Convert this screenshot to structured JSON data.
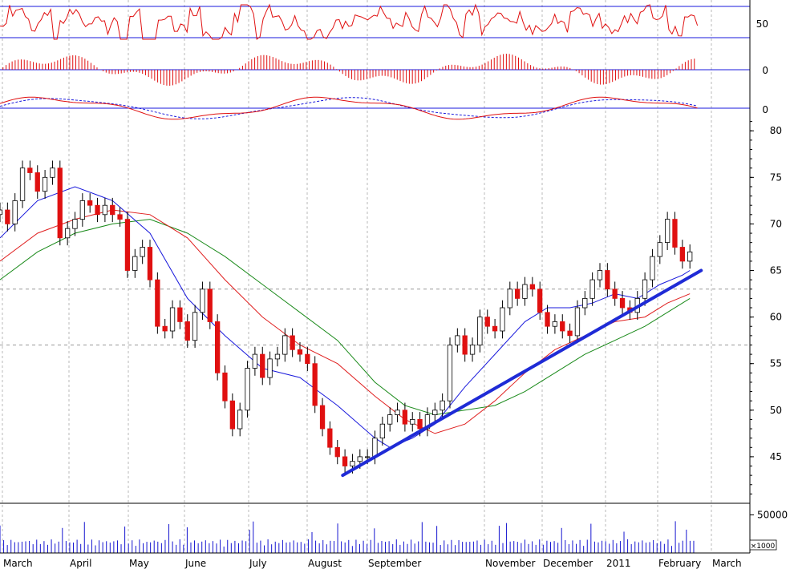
{
  "chart_data": {
    "type": "stock-chart",
    "x_axis": {
      "labels": [
        "March",
        "April",
        "May",
        "June",
        "July",
        "August",
        "September",
        "November",
        "December",
        "2011",
        "February",
        "March"
      ]
    },
    "price_panel": {
      "type": "candlestick",
      "ylim": [
        40,
        82
      ],
      "y_ticks": [
        45,
        50,
        55,
        60,
        65,
        70,
        75,
        80
      ],
      "grid_dashed": [
        57,
        63
      ],
      "trendline": {
        "x": [
          0.457,
          0.935
        ],
        "y": [
          43.0,
          65.0
        ],
        "color": "#1f2bd6"
      },
      "moving_average_colors": {
        "short": "#1a1adc",
        "medium": "#e02020",
        "long": "#1a8a1a"
      },
      "candle_colors": {
        "up": "#ffffff",
        "down": "#e01010"
      },
      "close_series": [
        [
          0.0,
          71.5
        ],
        [
          0.01,
          70.0
        ],
        [
          0.02,
          72.5
        ],
        [
          0.03,
          76.0
        ],
        [
          0.04,
          75.5
        ],
        [
          0.05,
          73.5
        ],
        [
          0.06,
          75.0
        ],
        [
          0.07,
          76.0
        ],
        [
          0.08,
          68.5
        ],
        [
          0.09,
          69.5
        ],
        [
          0.1,
          70.5
        ],
        [
          0.11,
          72.5
        ],
        [
          0.12,
          72.0
        ],
        [
          0.13,
          71.0
        ],
        [
          0.14,
          72.0
        ],
        [
          0.15,
          71.0
        ],
        [
          0.16,
          70.5
        ],
        [
          0.17,
          65.0
        ],
        [
          0.18,
          66.5
        ],
        [
          0.19,
          67.5
        ],
        [
          0.2,
          64.0
        ],
        [
          0.21,
          59.0
        ],
        [
          0.22,
          58.5
        ],
        [
          0.23,
          61.0
        ],
        [
          0.24,
          59.5
        ],
        [
          0.25,
          57.5
        ],
        [
          0.26,
          60.5
        ],
        [
          0.27,
          63.0
        ],
        [
          0.28,
          59.5
        ],
        [
          0.29,
          54.0
        ],
        [
          0.3,
          51.0
        ],
        [
          0.31,
          48.0
        ],
        [
          0.32,
          50.0
        ],
        [
          0.33,
          54.5
        ],
        [
          0.34,
          56.0
        ],
        [
          0.35,
          53.5
        ],
        [
          0.36,
          55.5
        ],
        [
          0.37,
          56.0
        ],
        [
          0.38,
          58.0
        ],
        [
          0.39,
          56.5
        ],
        [
          0.4,
          56.0
        ],
        [
          0.41,
          55.0
        ],
        [
          0.42,
          50.5
        ],
        [
          0.43,
          48.0
        ],
        [
          0.44,
          46.0
        ],
        [
          0.45,
          45.0
        ],
        [
          0.46,
          44.0
        ],
        [
          0.47,
          44.5
        ],
        [
          0.48,
          45.0
        ],
        [
          0.49,
          45.0
        ],
        [
          0.5,
          47.0
        ],
        [
          0.51,
          48.5
        ],
        [
          0.52,
          49.5
        ],
        [
          0.53,
          50.0
        ],
        [
          0.54,
          48.5
        ],
        [
          0.55,
          49.0
        ],
        [
          0.56,
          48.0
        ],
        [
          0.57,
          49.5
        ],
        [
          0.58,
          50.0
        ],
        [
          0.59,
          51.0
        ],
        [
          0.6,
          57.0
        ],
        [
          0.61,
          58.0
        ],
        [
          0.62,
          56.0
        ],
        [
          0.63,
          57.0
        ],
        [
          0.64,
          60.0
        ],
        [
          0.65,
          59.0
        ],
        [
          0.66,
          58.5
        ],
        [
          0.67,
          61.0
        ],
        [
          0.68,
          63.0
        ],
        [
          0.69,
          62.0
        ],
        [
          0.7,
          63.5
        ],
        [
          0.71,
          63.0
        ],
        [
          0.72,
          60.5
        ],
        [
          0.73,
          59.0
        ],
        [
          0.74,
          59.5
        ],
        [
          0.75,
          58.5
        ],
        [
          0.76,
          58.0
        ],
        [
          0.77,
          61.0
        ],
        [
          0.78,
          62.0
        ],
        [
          0.79,
          64.0
        ],
        [
          0.8,
          65.0
        ],
        [
          0.81,
          63.0
        ],
        [
          0.82,
          62.0
        ],
        [
          0.83,
          61.0
        ],
        [
          0.84,
          60.5
        ],
        [
          0.85,
          62.0
        ],
        [
          0.86,
          64.0
        ],
        [
          0.87,
          66.5
        ],
        [
          0.88,
          68.0
        ],
        [
          0.89,
          70.5
        ],
        [
          0.9,
          67.5
        ],
        [
          0.91,
          66.0
        ],
        [
          0.92,
          67.0
        ]
      ],
      "ma_short": [
        [
          0.0,
          68.5
        ],
        [
          0.05,
          72.5
        ],
        [
          0.1,
          74.0
        ],
        [
          0.15,
          72.5
        ],
        [
          0.2,
          69.0
        ],
        [
          0.25,
          62.0
        ],
        [
          0.3,
          58.0
        ],
        [
          0.35,
          54.5
        ],
        [
          0.4,
          53.5
        ],
        [
          0.45,
          50.5
        ],
        [
          0.5,
          47.0
        ],
        [
          0.52,
          46.0
        ],
        [
          0.55,
          47.0
        ],
        [
          0.58,
          48.5
        ],
        [
          0.62,
          52.5
        ],
        [
          0.66,
          56.0
        ],
        [
          0.7,
          59.5
        ],
        [
          0.73,
          61.0
        ],
        [
          0.76,
          61.0
        ],
        [
          0.79,
          61.5
        ],
        [
          0.82,
          62.5
        ],
        [
          0.85,
          62.0
        ],
        [
          0.88,
          63.5
        ],
        [
          0.91,
          64.5
        ],
        [
          0.92,
          65.0
        ]
      ],
      "ma_medium": [
        [
          0.0,
          66.0
        ],
        [
          0.05,
          69.0
        ],
        [
          0.1,
          70.5
        ],
        [
          0.15,
          71.5
        ],
        [
          0.2,
          71.0
        ],
        [
          0.25,
          68.5
        ],
        [
          0.3,
          64.0
        ],
        [
          0.35,
          60.0
        ],
        [
          0.4,
          57.0
        ],
        [
          0.45,
          55.0
        ],
        [
          0.5,
          51.5
        ],
        [
          0.54,
          49.0
        ],
        [
          0.58,
          47.5
        ],
        [
          0.62,
          48.5
        ],
        [
          0.66,
          51.0
        ],
        [
          0.7,
          54.0
        ],
        [
          0.74,
          56.5
        ],
        [
          0.78,
          58.0
        ],
        [
          0.82,
          59.5
        ],
        [
          0.86,
          60.0
        ],
        [
          0.89,
          61.5
        ],
        [
          0.92,
          62.5
        ]
      ],
      "ma_long": [
        [
          0.0,
          64.0
        ],
        [
          0.05,
          67.0
        ],
        [
          0.1,
          69.0
        ],
        [
          0.15,
          70.0
        ],
        [
          0.2,
          70.5
        ],
        [
          0.25,
          69.0
        ],
        [
          0.3,
          66.5
        ],
        [
          0.35,
          63.5
        ],
        [
          0.4,
          60.5
        ],
        [
          0.45,
          57.5
        ],
        [
          0.5,
          53.0
        ],
        [
          0.54,
          50.5
        ],
        [
          0.58,
          49.5
        ],
        [
          0.62,
          50.0
        ],
        [
          0.66,
          50.5
        ],
        [
          0.7,
          52.0
        ],
        [
          0.74,
          54.0
        ],
        [
          0.78,
          56.0
        ],
        [
          0.82,
          57.5
        ],
        [
          0.86,
          59.0
        ],
        [
          0.89,
          60.5
        ],
        [
          0.92,
          62.0
        ]
      ]
    },
    "volume_panel": {
      "y_tick_labels": [
        "50000",
        "×1000"
      ],
      "ylim": [
        0,
        60000
      ],
      "bar_color": "#1515d0"
    },
    "rsi_panel": {
      "tick_label": "50",
      "levels": [
        70,
        30
      ],
      "ylim": [
        0,
        100
      ],
      "color": "#e01010"
    },
    "histogram_panel": {
      "tick_label": "0",
      "color": "#e01010"
    },
    "macd_panel": {
      "tick_label": "0",
      "colors": {
        "line": "#e01010",
        "signal": "#1a1adc"
      }
    }
  }
}
